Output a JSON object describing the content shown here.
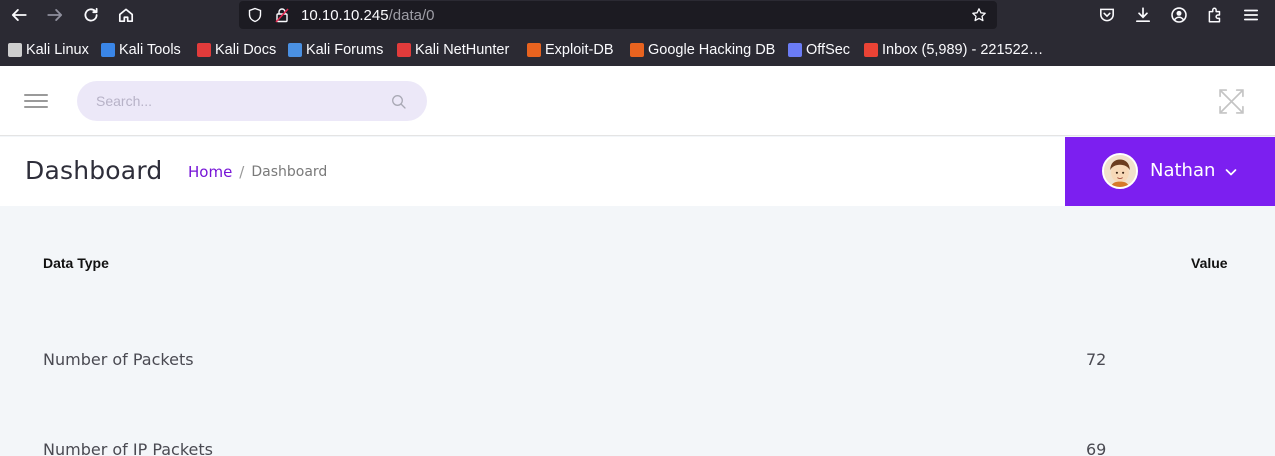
{
  "browser": {
    "url_host": "10.10.10.245",
    "url_path": "/data/0",
    "bookmarks": [
      {
        "label": "Kali Linux",
        "color": "#d8d8d8"
      },
      {
        "label": "Kali Tools",
        "color": "#3a86e8"
      },
      {
        "label": "Kali Docs",
        "color": "#e23b3b"
      },
      {
        "label": "Kali Forums",
        "color": "#4a90e2"
      },
      {
        "label": "Kali NetHunter",
        "color": "#e23b3b"
      },
      {
        "label": "Exploit-DB",
        "color": "#e8631f"
      },
      {
        "label": "Google Hacking DB",
        "color": "#e8631f"
      },
      {
        "label": "OffSec",
        "color": "#6b7cf5"
      },
      {
        "label": "Inbox (5,989) - 221522…",
        "color": "#ea4335"
      }
    ]
  },
  "header": {
    "search_placeholder": "Search..."
  },
  "titlebar": {
    "title": "Dashboard",
    "breadcrumb_home": "Home",
    "breadcrumb_sep": "/",
    "breadcrumb_current": "Dashboard"
  },
  "user": {
    "name": "Nathan"
  },
  "table": {
    "col_type": "Data Type",
    "col_value": "Value",
    "rows": [
      {
        "type": "Number of Packets",
        "value": "72"
      },
      {
        "type": "Number of IP Packets",
        "value": "69"
      }
    ]
  },
  "colors": {
    "accent": "#7c1ff0",
    "link": "#7614d6"
  }
}
